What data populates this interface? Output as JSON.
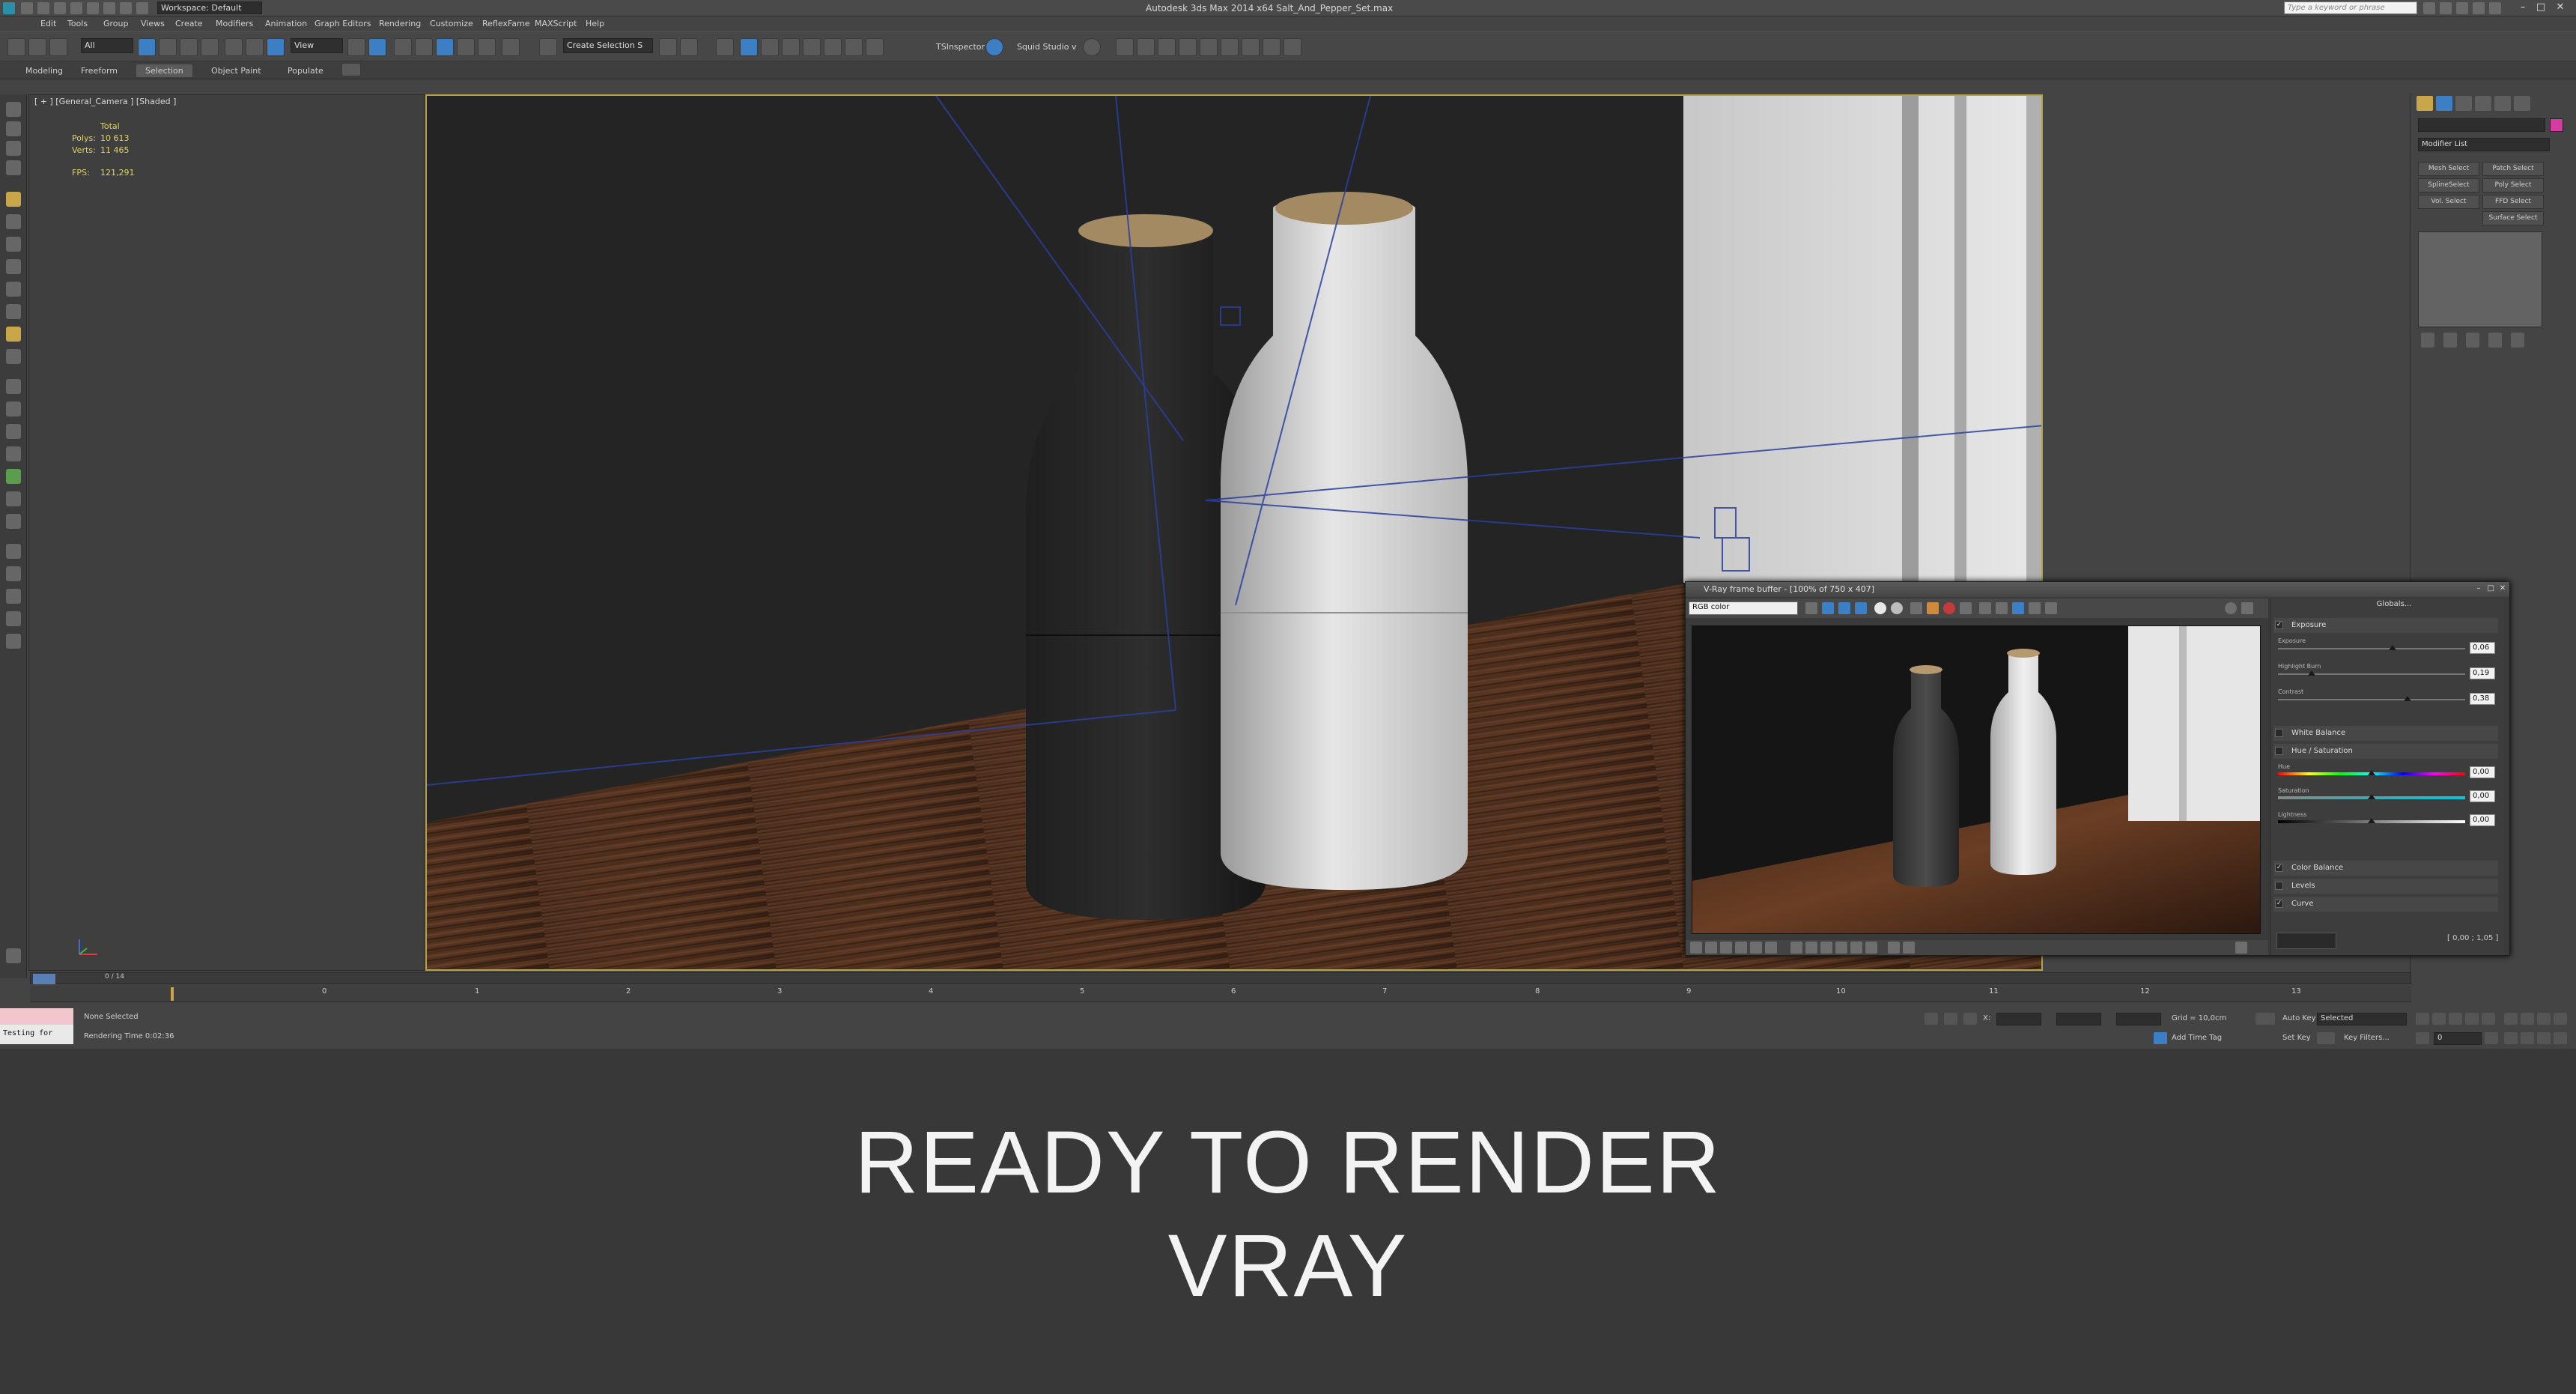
{
  "titlebar": {
    "title": "Autodesk 3ds Max  2014 x64    Salt_And_Pepper_Set.max",
    "workspace": "Workspace: Default",
    "search_placeholder": "Type a keyword or phrase"
  },
  "menu": [
    "Edit",
    "Tools",
    "Group",
    "Views",
    "Create",
    "Modifiers",
    "Animation",
    "Graph Editors",
    "Rendering",
    "Customize",
    "ReflexFame",
    "MAXScript",
    "Help"
  ],
  "toolbar": {
    "filter": "All",
    "ref_coord": "View",
    "selection_set": "Create Selection S",
    "tsinspector": "TSInspector",
    "squid": "Squid Studio v"
  },
  "ribbon": {
    "tabs": [
      "Modeling",
      "Freeform",
      "Selection",
      "Object Paint",
      "Populate"
    ],
    "active": "Selection"
  },
  "viewport": {
    "label": "[ + ] [General_Camera ] [Shaded ]",
    "stats": {
      "total_label": "Total",
      "polys_label": "Polys:",
      "polys_value": "10 613",
      "verts_label": "Verts:",
      "verts_value": "11 465",
      "fps_label": "FPS:",
      "fps_value": "121,291"
    }
  },
  "command_panel": {
    "modifier_list": "Modifier List",
    "buttons": [
      "Mesh Select",
      "Patch Select",
      "SplineSelect",
      "Poly Select",
      "Vol. Select",
      "FFD Select",
      "",
      "Surface Select"
    ]
  },
  "vfb": {
    "title": "V-Ray frame buffer - [100% of 750 x 407]",
    "channel": "RGB color",
    "globals": "Globals...",
    "rows": {
      "exposure": "Exposure",
      "exposure_sub": "Exposure",
      "exposure_value": "0,06",
      "highlight": "Highlight Burn",
      "highlight_value": "0,19",
      "contrast": "Contrast",
      "contrast_value": "0,38",
      "white_balance": "White Balance",
      "hue_sat": "Hue / Saturation",
      "hue": "Hue",
      "hue_value": "0,00",
      "saturation": "Saturation",
      "saturation_value": "0,00",
      "lightness": "Lightness",
      "lightness_value": "0,00",
      "color_balance": "Color Balance",
      "levels": "Levels",
      "curve": "Curve",
      "coord": "[ 0,00 ; 1,05 ]"
    }
  },
  "timeline": {
    "frame": "0 / 14",
    "ticks": [
      "0",
      "1",
      "2",
      "3",
      "4",
      "5",
      "6",
      "7",
      "8",
      "9",
      "10",
      "11",
      "12",
      "13"
    ]
  },
  "status": {
    "maxscript": "Testing for",
    "none_selected": "None Selected",
    "render_time": "Rendering Time  0:02:36",
    "x_label": "X:",
    "grid": "Grid = 10,0cm",
    "add_time_tag": "Add Time Tag",
    "auto_key": "Auto Key",
    "selected": "Selected",
    "set_key": "Set Key",
    "key_filters": "Key Filters...",
    "frame_field": "0"
  },
  "caption": {
    "line1": "READY TO RENDER",
    "line2": "VRAY"
  },
  "colors": {
    "viewport_border": "#b5a44a",
    "stats_text": "#e0d36a",
    "active_blue": "#3d7fc4",
    "object_color": "#d63ba2"
  }
}
